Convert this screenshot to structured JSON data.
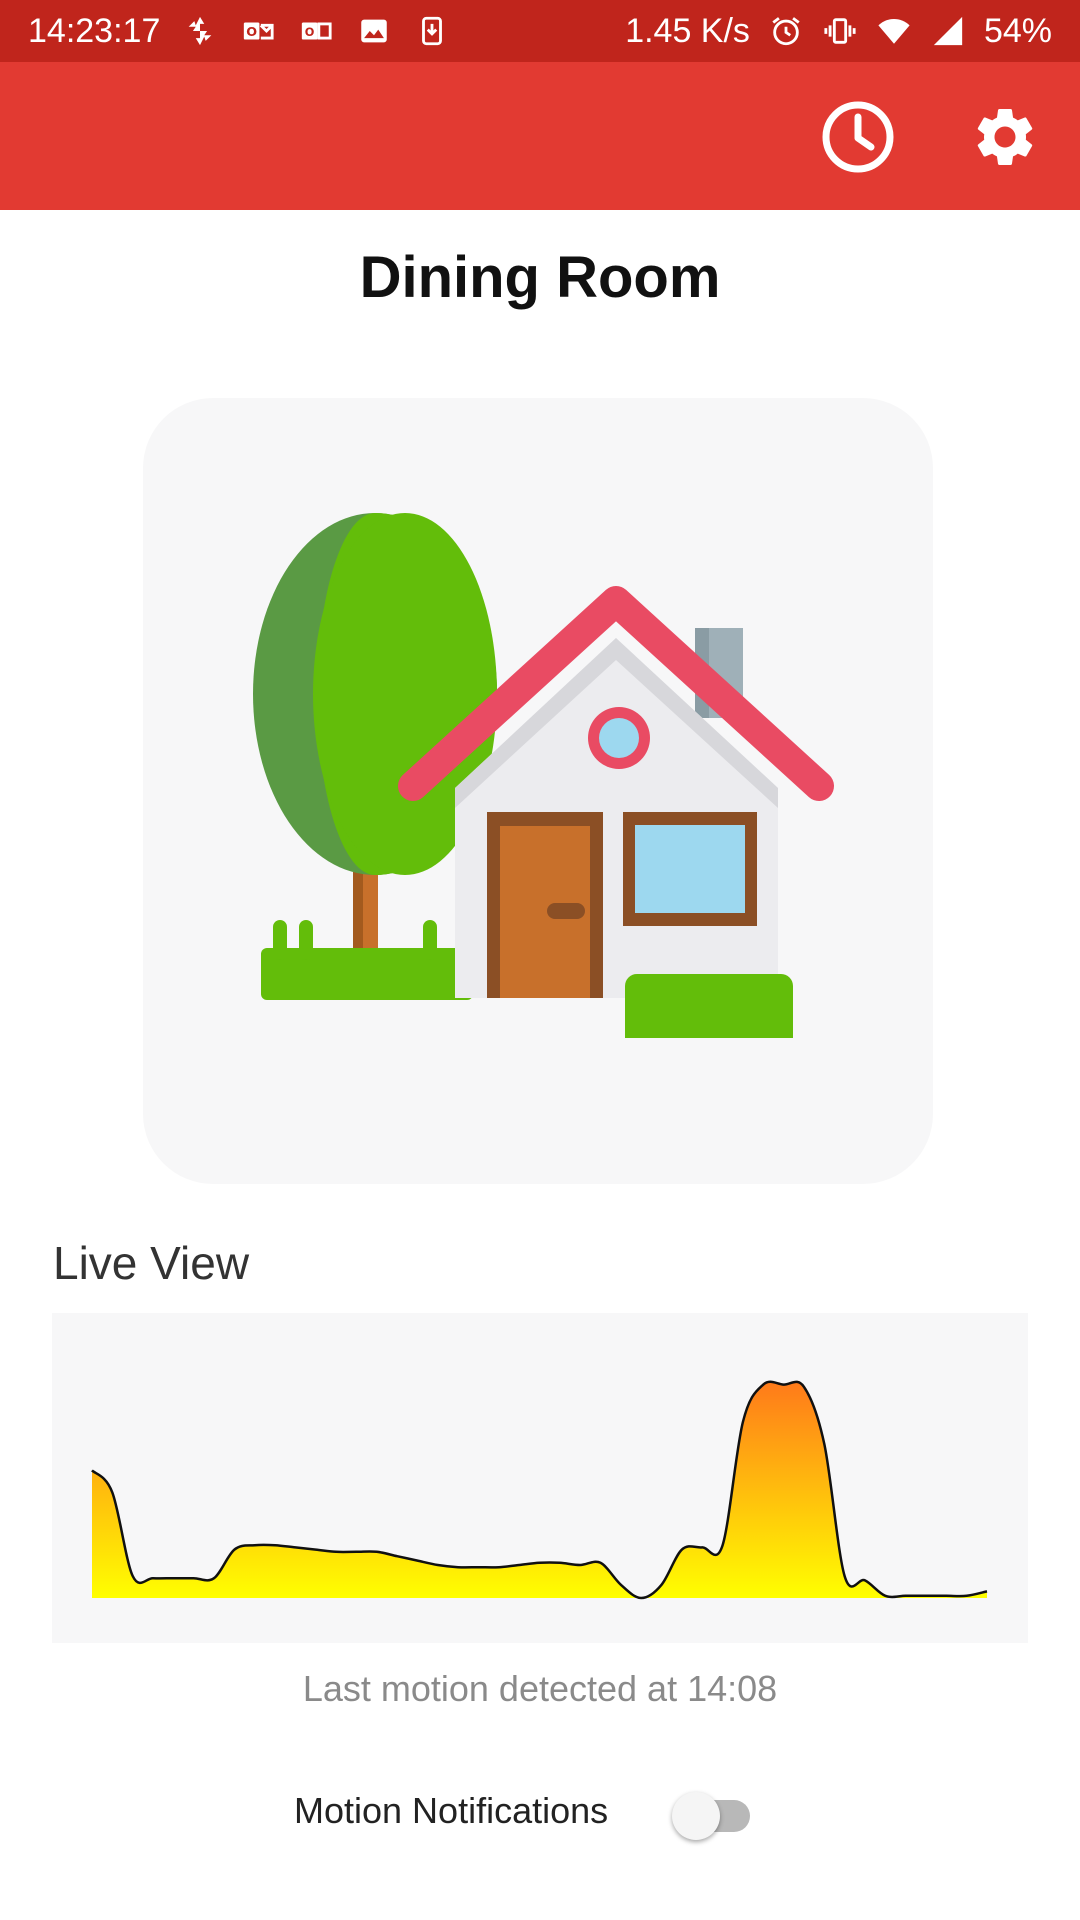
{
  "status_bar": {
    "time": "14:23:17",
    "network_speed": "1.45 K/s",
    "battery": "54%",
    "left_icons": [
      "pinwheel-icon",
      "outlook-icon",
      "office-icon",
      "image-icon",
      "download-icon"
    ],
    "right_icons": [
      "alarm-icon",
      "vibrate-icon",
      "wifi-icon",
      "signal-icon"
    ]
  },
  "app_bar": {
    "background": "#e23a32",
    "actions": [
      "history-icon",
      "settings-icon"
    ]
  },
  "room": {
    "title": "Dining Room"
  },
  "live_view": {
    "label": "Live View",
    "last_motion": "Last motion detected at 14:08"
  },
  "notifications": {
    "label": "Motion Notifications",
    "enabled": false
  },
  "chart_data": {
    "type": "area",
    "title": "",
    "xlabel": "",
    "ylabel": "",
    "grid": false,
    "legend": "none",
    "ylim": [
      0,
      100
    ],
    "x": [
      0,
      1,
      2,
      3,
      4,
      5,
      6,
      7,
      8,
      9,
      10,
      11,
      12,
      13,
      14,
      15,
      16,
      17,
      18,
      19,
      20,
      21,
      22,
      23,
      24,
      25,
      26,
      27,
      28,
      29,
      30,
      31,
      32,
      33,
      34,
      35,
      36,
      37,
      38,
      39,
      40,
      41,
      42,
      43,
      44
    ],
    "values": [
      58,
      48,
      10,
      9,
      9,
      9,
      9,
      22,
      24,
      24,
      23,
      22,
      21,
      21,
      21,
      19,
      17,
      15,
      14,
      14,
      14,
      15,
      16,
      16,
      15,
      16,
      6,
      0,
      6,
      22,
      23,
      24,
      80,
      97,
      97,
      96,
      70,
      10,
      8,
      1,
      1,
      1,
      1,
      1,
      3
    ],
    "gradient": [
      "#ffff00",
      "#ff7a1a"
    ]
  }
}
